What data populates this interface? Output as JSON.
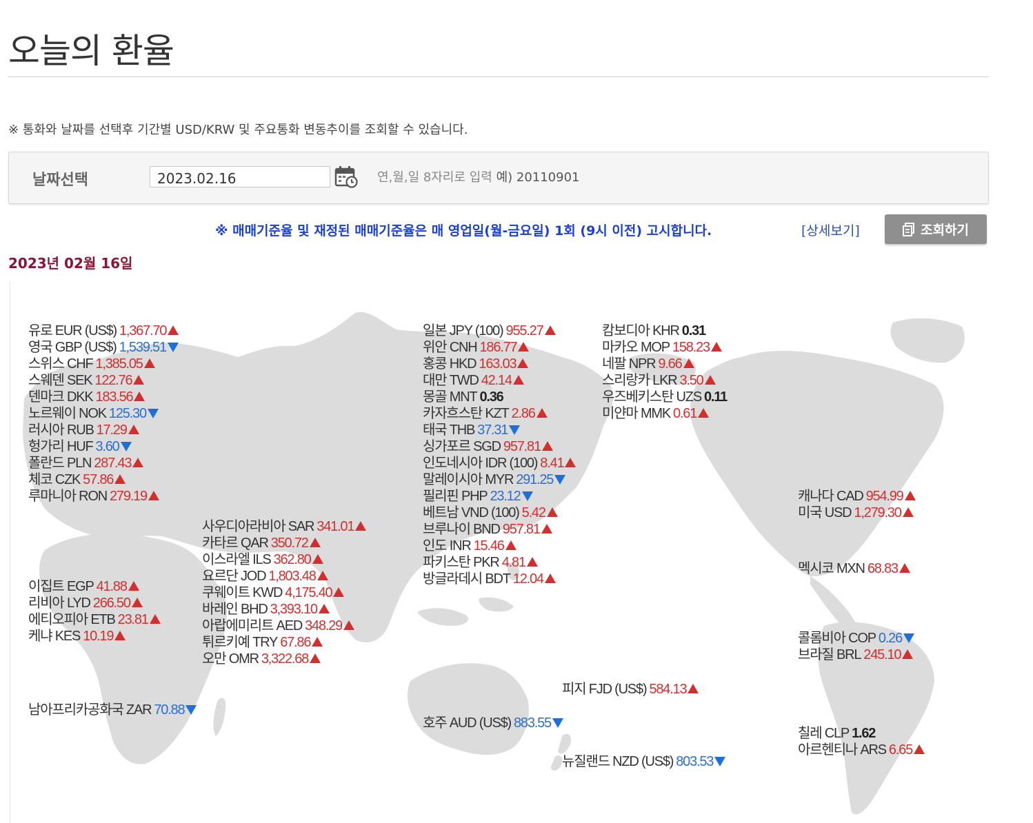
{
  "header": {
    "title": "오늘의 환율"
  },
  "notice": "※ 통화와 날짜를 선택후 기간별 USD/KRW 및 주요통화 변동추이를 조회할 수 있습니다.",
  "date_select": {
    "label": "날짜선택",
    "value": "2023.02.16",
    "hint": "연,월,일 8자리로 입력",
    "example": "예) 20110901"
  },
  "announcement": "※ 매매기준율 및 재정된 매매기준율은 매 영업일(월-금요일) 1회 (9시 이전) 고시합니다.",
  "detail_link": "[상세보기]",
  "search_button": "조회하기",
  "date_heading": "2023년 02월 16일",
  "colors": {
    "up": "#d32f2f",
    "down": "#1f6fd8",
    "heading": "#8a1436",
    "announce": "#1a3fd6"
  },
  "groups": {
    "europe": [
      {
        "name": "유로 EUR (US$)",
        "value": "1,367.70",
        "dir": "up"
      },
      {
        "name": "영국 GBP (US$)",
        "value": "1,539.51",
        "dir": "down"
      },
      {
        "name": "스위스 CHF",
        "value": "1,385.05",
        "dir": "up"
      },
      {
        "name": "스웨덴 SEK",
        "value": "122.76",
        "dir": "up"
      },
      {
        "name": "덴마크 DKK",
        "value": "183.56",
        "dir": "up"
      },
      {
        "name": "노르웨이 NOK",
        "value": "125.30",
        "dir": "down"
      },
      {
        "name": "러시아 RUB",
        "value": "17.29",
        "dir": "up"
      },
      {
        "name": "헝가리 HUF",
        "value": "3.60",
        "dir": "down"
      },
      {
        "name": "폴란드 PLN",
        "value": "287.43",
        "dir": "up"
      },
      {
        "name": "체코 CZK",
        "value": "57.86",
        "dir": "up"
      },
      {
        "name": "루마니아 RON",
        "value": "279.19",
        "dir": "up"
      }
    ],
    "africa": [
      {
        "name": "이집트 EGP",
        "value": "41.88",
        "dir": "up"
      },
      {
        "name": "리비아 LYD",
        "value": "266.50",
        "dir": "up"
      },
      {
        "name": "에티오피아 ETB",
        "value": "23.81",
        "dir": "up"
      },
      {
        "name": "케냐 KES",
        "value": "10.19",
        "dir": "up"
      }
    ],
    "south_africa": [
      {
        "name": "남아프리카공화국 ZAR",
        "value": "70.88",
        "dir": "down"
      }
    ],
    "middle_east": [
      {
        "name": "사우디아라비아 SAR",
        "value": "341.01",
        "dir": "up"
      },
      {
        "name": "카타르 QAR",
        "value": "350.72",
        "dir": "up"
      },
      {
        "name": "이스라엘 ILS",
        "value": "362.80",
        "dir": "up"
      },
      {
        "name": "요르단 JOD",
        "value": "1,803.48",
        "dir": "up"
      },
      {
        "name": "쿠웨이트 KWD",
        "value": "4,175.40",
        "dir": "up"
      },
      {
        "name": "바레인 BHD",
        "value": "3,393.10",
        "dir": "up"
      },
      {
        "name": "아랍에미리트 AED",
        "value": "348.29",
        "dir": "up"
      },
      {
        "name": "튀르키예 TRY",
        "value": "67.86",
        "dir": "up"
      },
      {
        "name": "오만 OMR",
        "value": "3,322.68",
        "dir": "up"
      }
    ],
    "asia1": [
      {
        "name": "일본 JPY (100)",
        "value": "955.27",
        "dir": "up"
      },
      {
        "name": "위안 CNH",
        "value": "186.77",
        "dir": "up"
      },
      {
        "name": "홍콩 HKD",
        "value": "163.03",
        "dir": "up"
      },
      {
        "name": "대만 TWD",
        "value": "42.14",
        "dir": "up"
      },
      {
        "name": "몽골 MNT",
        "value": "0.36",
        "dir": "flat"
      },
      {
        "name": "카자흐스탄 KZT",
        "value": "2.86",
        "dir": "up"
      },
      {
        "name": "태국 THB",
        "value": "37.31",
        "dir": "down"
      },
      {
        "name": "싱가포르 SGD",
        "value": "957.81",
        "dir": "up"
      },
      {
        "name": "인도네시아 IDR (100)",
        "value": "8.41",
        "dir": "up"
      },
      {
        "name": "말레이시아 MYR",
        "value": "291.25",
        "dir": "down"
      },
      {
        "name": "필리핀 PHP",
        "value": "23.12",
        "dir": "down"
      },
      {
        "name": "베트남 VND (100)",
        "value": "5.42",
        "dir": "up"
      },
      {
        "name": "브루나이 BND",
        "value": "957.81",
        "dir": "up"
      },
      {
        "name": "인도 INR",
        "value": "15.46",
        "dir": "up"
      },
      {
        "name": "파키스탄 PKR",
        "value": "4.81",
        "dir": "up"
      },
      {
        "name": "방글라데시 BDT",
        "value": "12.04",
        "dir": "up"
      }
    ],
    "asia2": [
      {
        "name": "캄보디아 KHR",
        "value": "0.31",
        "dir": "flat"
      },
      {
        "name": "마카오 MOP",
        "value": "158.23",
        "dir": "up"
      },
      {
        "name": "네팔 NPR",
        "value": "9.66",
        "dir": "up"
      },
      {
        "name": "스리랑카 LKR",
        "value": "3.50",
        "dir": "up"
      },
      {
        "name": "우즈베키스탄 UZS",
        "value": "0.11",
        "dir": "flat"
      },
      {
        "name": "미얀마 MMK",
        "value": "0.61",
        "dir": "up"
      }
    ],
    "oceania_fiji": [
      {
        "name": "피지 FJD (US$)",
        "value": "584.13",
        "dir": "up"
      }
    ],
    "oceania_aus": [
      {
        "name": "호주 AUD (US$)",
        "value": "883.55",
        "dir": "down"
      }
    ],
    "oceania_nz": [
      {
        "name": "뉴질랜드 NZD (US$)",
        "value": "803.53",
        "dir": "down"
      }
    ],
    "north_america": [
      {
        "name": "캐나다 CAD",
        "value": "954.99",
        "dir": "up"
      },
      {
        "name": "미국 USD",
        "value": "1,279.30",
        "dir": "up"
      }
    ],
    "mexico": [
      {
        "name": "멕시코 MXN",
        "value": "68.83",
        "dir": "up"
      }
    ],
    "south_america1": [
      {
        "name": "콜롬비아 COP",
        "value": "0.26",
        "dir": "down"
      },
      {
        "name": "브라질 BRL",
        "value": "245.10",
        "dir": "up"
      }
    ],
    "south_america2": [
      {
        "name": "칠레 CLP",
        "value": "1.62",
        "dir": "flat"
      },
      {
        "name": "아르헨티나 ARS",
        "value": "6.65",
        "dir": "up"
      }
    ]
  }
}
